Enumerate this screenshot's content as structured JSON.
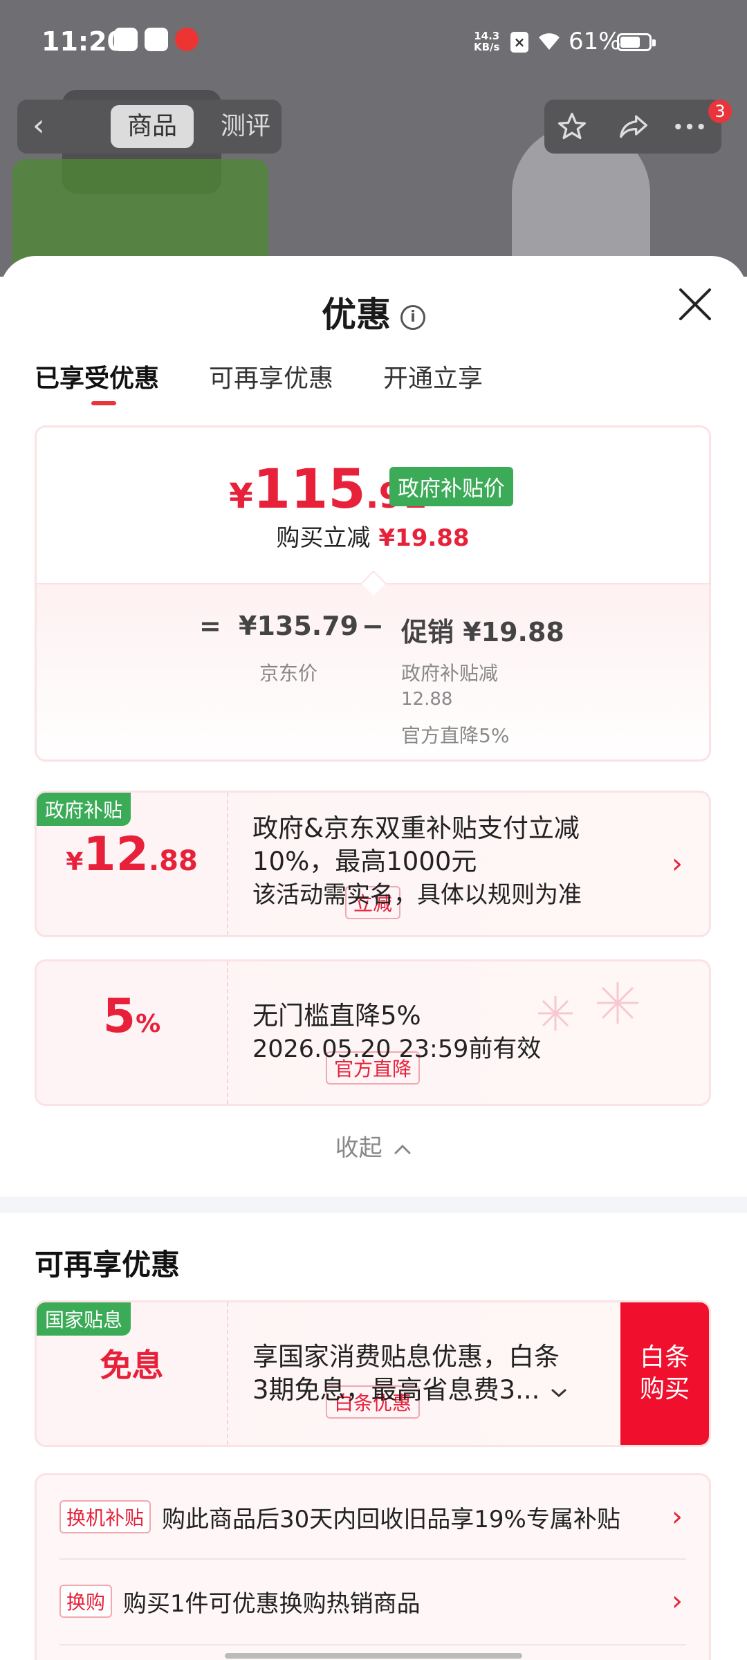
{
  "status": {
    "time": "11:20",
    "net_speed": "14.3",
    "net_unit": "KB/s",
    "battery": "61%"
  },
  "topnav": {
    "tab_product": "商品",
    "tab_review": "测评",
    "more_badge": "3"
  },
  "sheet": {
    "title": "优惠",
    "tabs": [
      "已享受优惠",
      "可再享优惠",
      "开通立享"
    ]
  },
  "price": {
    "currency": "¥",
    "int": "115",
    "dec": ".91",
    "tag": "政府补贴价",
    "reduce_label": "购买立减",
    "reduce_value": "¥19.88",
    "eq": "=",
    "jd_price": "¥135.79",
    "minus": "−",
    "promo": "促销 ¥19.88",
    "jd_label": "京东价",
    "promo_sub1": "政府补贴减",
    "promo_sub2": "12.88",
    "promo_sub3": "官方直降5%"
  },
  "offers": [
    {
      "corner": "政府补贴",
      "amount_symbol": "¥",
      "amount_int": "12",
      "amount_dec": ".88",
      "pill": "立减",
      "line1": "政府&京东双重补贴支付立减",
      "line2": "10%，最高1000元",
      "line3": "该活动需实名，具体以规则为准"
    },
    {
      "amount_int": "5",
      "amount_unit": "%",
      "pill": "官方直降",
      "line1": "无门槛直降5%",
      "line2": "2026.05.20 23:59前有效"
    }
  ],
  "collapse": "收起",
  "section2_title": "可再享优惠",
  "baitiao": {
    "corner": "国家贴息",
    "big": "免息",
    "pill": "白条优惠",
    "line1": "享国家消费贴息优惠，白条",
    "line2": "3期免息，最高省息费3...",
    "button": "白条购买"
  },
  "more": [
    {
      "tag": "换机补贴",
      "text": "购此商品后30天内回收旧品享19%专属补贴"
    },
    {
      "tag": "换购",
      "text": "购买1件可优惠换购热销商品"
    }
  ],
  "colors": {
    "accent": "#e8213a",
    "green_tag": "#3cab58",
    "buy_button": "#f00f2c"
  }
}
